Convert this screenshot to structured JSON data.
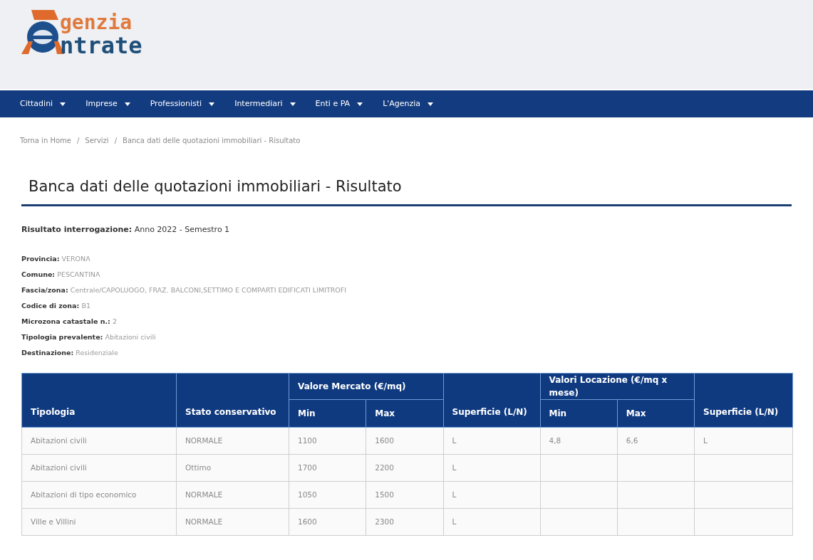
{
  "logo": {
    "line_1": "genzia",
    "line_2": "ntrate"
  },
  "nav": {
    "items": [
      {
        "label": "Cittadini"
      },
      {
        "label": "Imprese"
      },
      {
        "label": "Professionisti"
      },
      {
        "label": "Intermediari"
      },
      {
        "label": "Enti e PA"
      },
      {
        "label": "L'Agenzia"
      }
    ]
  },
  "breadcrumb": [
    "Torna in Home",
    "Servizi",
    "Banca dati delle quotazioni immobiliari - Risultato"
  ],
  "breadcrumb_separator": "/",
  "title": "Banca dati delle quotazioni immobiliari - Risultato",
  "result": {
    "label": "Risultato interrogazione:",
    "value": "Anno 2022 - Semestro 1"
  },
  "fields": [
    {
      "label": "Provincia:",
      "value": "VERONA"
    },
    {
      "label": "Comune:",
      "value": "PESCANTINA"
    },
    {
      "label": "Fascia/zona:",
      "value": "Centrale/CAPOLUOGO, FRAZ. BALCONI,SETTIMO E COMPARTI EDIFICATI LIMITROFI"
    },
    {
      "label": "Codice di zona:",
      "value": "B1"
    },
    {
      "label": "Microzona catastale n.:",
      "value": "2"
    },
    {
      "label": "Tipologia prevalente:",
      "value": "Abitazioni civili"
    },
    {
      "label": "Destinazione:",
      "value": "Residenziale"
    }
  ],
  "table": {
    "group_headers": [
      "Valore Mercato (€/mq)",
      "Valori Locazione (€/mq x mese)"
    ],
    "columns": [
      "Tipologia",
      "Stato conservativo",
      "Min",
      "Max",
      "Superficie (L/N)",
      "Min",
      "Max",
      "Superficie (L/N)"
    ],
    "rows": [
      [
        "Abitazioni civili",
        "NORMALE",
        "1100",
        "1600",
        "L",
        "4,8",
        "6,6",
        "L"
      ],
      [
        "Abitazioni civili",
        "Ottimo",
        "1700",
        "2200",
        "L",
        "",
        "",
        ""
      ],
      [
        "Abitazioni di tipo economico",
        "NORMALE",
        "1050",
        "1500",
        "L",
        "",
        "",
        ""
      ],
      [
        "Ville e Villini",
        "NORMALE",
        "1600",
        "2300",
        "L",
        "",
        "",
        ""
      ]
    ]
  }
}
